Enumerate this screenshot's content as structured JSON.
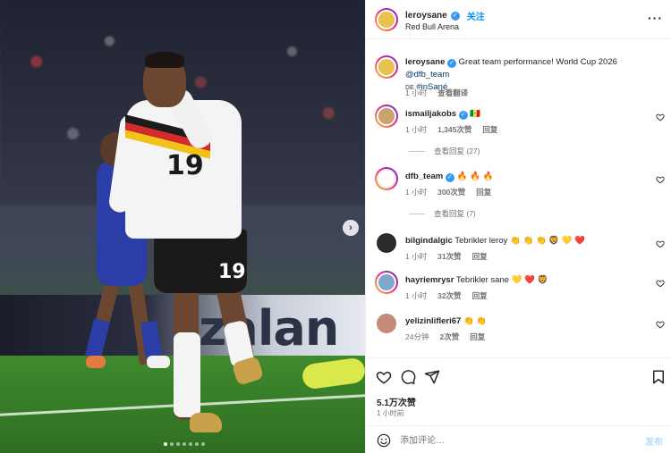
{
  "post": {
    "username": "leroysane",
    "follow_label": "关注",
    "location": "Red Bull Arena",
    "caption_username": "leroysane",
    "caption_text": "Great team performance! World Cup 2026",
    "caption_mention": "@dfb_team",
    "caption_flag": "DE",
    "caption_hashtag": "#inSané",
    "caption_time": "1 小时",
    "caption_translate": "查看翻译",
    "board_text": "zalan",
    "shirt_number": "19"
  },
  "comments": [
    {
      "username": "ismailjakobs",
      "text": "🇸🇳",
      "time": "1 小时",
      "likes": "1,345次赞",
      "reply": "回复",
      "replies_label": "查看回复 (27)",
      "avatar_color": "#c8a36b"
    },
    {
      "username": "dfb_team",
      "text": "🔥 🔥 🔥",
      "time": "1 小时",
      "likes": "300次赞",
      "reply": "回复",
      "replies_label": "查看回复 (7)",
      "avatar_color": "#ffffff"
    },
    {
      "username": "bilgindalgic",
      "text": "Tebrikler leroy 👏 👏 👏 🦁 💛 ❤️",
      "time": "1 小时",
      "likes": "31次赞",
      "reply": "回复",
      "avatar_color": "#2a2a2a"
    },
    {
      "username": "hayriemrysr",
      "text": "Tebrikler sane 💛 ❤️ 🦁",
      "time": "1 小时",
      "likes": "32次赞",
      "reply": "回复",
      "avatar_color": "#7fa7c9"
    },
    {
      "username": "yelizinlifleri67",
      "text": "👏 👏",
      "time": "24分钟",
      "likes": "2次赞",
      "reply": "回复",
      "avatar_color": "#c48a7a"
    }
  ],
  "actions": {
    "likes": "5.1万次赞",
    "time_ago": "1 小时前"
  },
  "compose": {
    "placeholder": "添加评论…",
    "post_label": "发布"
  },
  "icons": [
    "chevron-right-icon",
    "more-icon",
    "heart-icon",
    "comment-icon",
    "share-icon",
    "bookmark-icon",
    "emoji-icon",
    "verified-icon"
  ],
  "colors": {
    "accent": "#0095f6",
    "verified": "#3897f0",
    "muted": "#737373",
    "text": "#262626"
  }
}
